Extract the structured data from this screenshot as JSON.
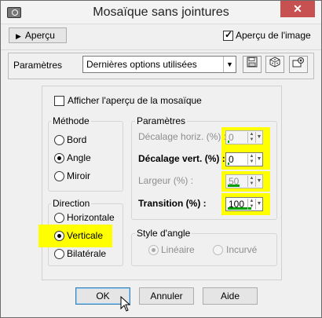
{
  "window": {
    "title": "Mosaïque sans jointures",
    "close_glyph": "✕"
  },
  "toolbar": {
    "apercu_label": "Aperçu",
    "apercu_image_label": "Aperçu de l'image",
    "apercu_image_checked": true
  },
  "params_bar": {
    "label": "Paramètres",
    "preset_value": "Dernières options utilisées"
  },
  "main": {
    "afficher_label": "Afficher l'aperçu de la mosaïque",
    "methode": {
      "title": "Méthode",
      "options": [
        "Bord",
        "Angle",
        "Miroir"
      ],
      "selected": "Angle"
    },
    "direction": {
      "title": "Direction",
      "options": [
        "Horizontale",
        "Verticale",
        "Bilatérale"
      ],
      "selected": "Verticale"
    },
    "parametres": {
      "title": "Paramètres",
      "fields": [
        {
          "label": "Décalage horiz. (%) :",
          "value": "0",
          "enabled": false,
          "level": 0
        },
        {
          "label": "Décalage vert. (%) :",
          "value": "0",
          "enabled": true,
          "level": 0
        },
        {
          "label": "Largeur (%) :",
          "value": "50",
          "enabled": false,
          "level": 50
        },
        {
          "label": "Transition (%) :",
          "value": "100",
          "enabled": true,
          "level": 100
        }
      ]
    },
    "style_angle": {
      "title": "Style d'angle",
      "options": [
        "Linéaire",
        "Incurvé"
      ],
      "selected": "Linéaire"
    }
  },
  "buttons": {
    "ok": "OK",
    "annuler": "Annuler",
    "aide": "Aide"
  },
  "colors": {
    "highlight": "#ffff00",
    "close_button": "#c75050",
    "spin_level": "#00a000"
  }
}
